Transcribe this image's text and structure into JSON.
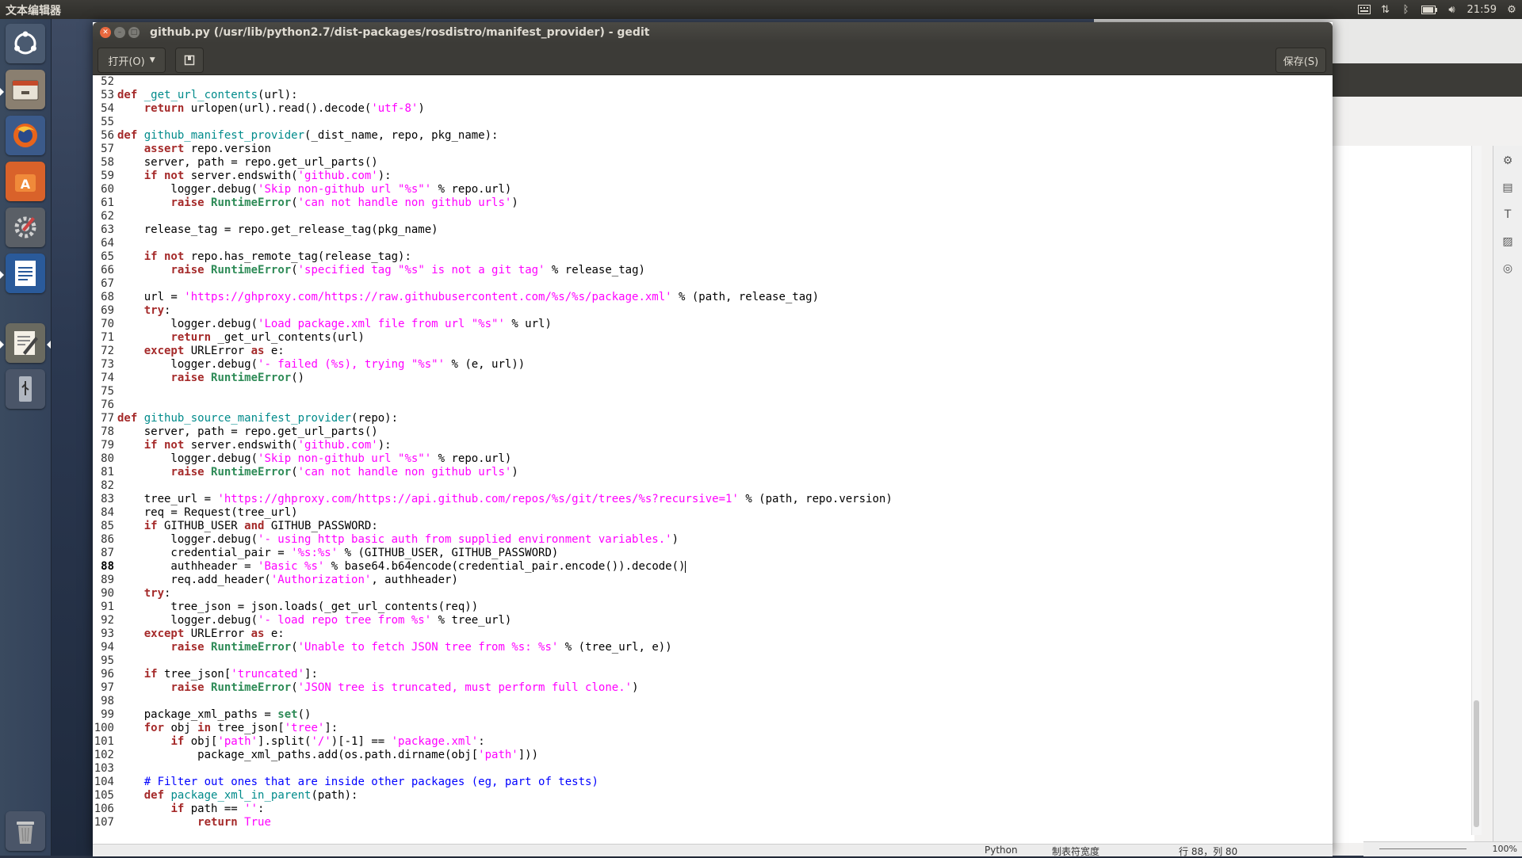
{
  "top_panel": {
    "app_title": "文本编辑器",
    "clock": "21:59",
    "indicators": [
      "keyboard-icon",
      "network-icon",
      "bluetooth-icon",
      "battery-icon",
      "volume-icon",
      "gear-icon"
    ]
  },
  "launcher": {
    "items": [
      "ubuntu-dash",
      "files",
      "firefox",
      "software-center",
      "system-settings",
      "libreoffice-writer",
      "text-editor",
      "usb-drive",
      "trash"
    ]
  },
  "window": {
    "title": "github.py (/usr/lib/python2.7/dist-packages/rosdistro/manifest_provider) - gedit",
    "open_label": "打开(O)",
    "save_label": "保存(S)"
  },
  "editor": {
    "current_line": 88,
    "lines": [
      {
        "n": "52",
        "t": []
      },
      {
        "n": "53",
        "t": [
          [
            "kw",
            "def"
          ],
          [
            "ct",
            " "
          ],
          [
            "fn",
            "_get_url_contents"
          ],
          [
            "ct",
            "(url):"
          ]
        ]
      },
      {
        "n": "54",
        "t": [
          [
            "ct",
            "    "
          ],
          [
            "kw",
            "return"
          ],
          [
            "ct",
            " urlopen(url).read().decode("
          ],
          [
            "st",
            "'utf-8'"
          ],
          [
            "ct",
            ")"
          ]
        ]
      },
      {
        "n": "55",
        "t": []
      },
      {
        "n": "56",
        "t": [
          [
            "kw",
            "def"
          ],
          [
            "ct",
            " "
          ],
          [
            "fn",
            "github_manifest_provider"
          ],
          [
            "ct",
            "(_dist_name, repo, pkg_name):"
          ]
        ]
      },
      {
        "n": "57",
        "t": [
          [
            "ct",
            "    "
          ],
          [
            "kw",
            "assert"
          ],
          [
            "ct",
            " repo.version"
          ]
        ]
      },
      {
        "n": "58",
        "t": [
          [
            "ct",
            "    server, path = repo.get_url_parts()"
          ]
        ]
      },
      {
        "n": "59",
        "t": [
          [
            "ct",
            "    "
          ],
          [
            "kw",
            "if not"
          ],
          [
            "ct",
            " server.endswith("
          ],
          [
            "st",
            "'github.com'"
          ],
          [
            "ct",
            "):"
          ]
        ]
      },
      {
        "n": "60",
        "t": [
          [
            "ct",
            "        logger.debug("
          ],
          [
            "st",
            "'Skip non-github url \"%s\"'"
          ],
          [
            "ct",
            " % repo.url)"
          ]
        ]
      },
      {
        "n": "61",
        "t": [
          [
            "ct",
            "        "
          ],
          [
            "kw",
            "raise"
          ],
          [
            "ct",
            " "
          ],
          [
            "bi",
            "RuntimeError"
          ],
          [
            "ct",
            "("
          ],
          [
            "st",
            "'can not handle non github urls'"
          ],
          [
            "ct",
            ")"
          ]
        ]
      },
      {
        "n": "62",
        "t": []
      },
      {
        "n": "63",
        "t": [
          [
            "ct",
            "    release_tag = repo.get_release_tag(pkg_name)"
          ]
        ]
      },
      {
        "n": "64",
        "t": []
      },
      {
        "n": "65",
        "t": [
          [
            "ct",
            "    "
          ],
          [
            "kw",
            "if not"
          ],
          [
            "ct",
            " repo.has_remote_tag(release_tag):"
          ]
        ]
      },
      {
        "n": "66",
        "t": [
          [
            "ct",
            "        "
          ],
          [
            "kw",
            "raise"
          ],
          [
            "ct",
            " "
          ],
          [
            "bi",
            "RuntimeError"
          ],
          [
            "ct",
            "("
          ],
          [
            "st",
            "'specified tag \"%s\" is not a git tag'"
          ],
          [
            "ct",
            " % release_tag)"
          ]
        ]
      },
      {
        "n": "67",
        "t": []
      },
      {
        "n": "68",
        "t": [
          [
            "ct",
            "    url = "
          ],
          [
            "st",
            "'https://ghproxy.com/https://raw.githubusercontent.com/%s/%s/package.xml'"
          ],
          [
            "ct",
            " % (path, release_tag)"
          ]
        ]
      },
      {
        "n": "69",
        "t": [
          [
            "ct",
            "    "
          ],
          [
            "kw",
            "try"
          ],
          [
            "ct",
            ":"
          ]
        ]
      },
      {
        "n": "70",
        "t": [
          [
            "ct",
            "        logger.debug("
          ],
          [
            "st",
            "'Load package.xml file from url \"%s\"'"
          ],
          [
            "ct",
            " % url)"
          ]
        ]
      },
      {
        "n": "71",
        "t": [
          [
            "ct",
            "        "
          ],
          [
            "kw",
            "return"
          ],
          [
            "ct",
            " _get_url_contents(url)"
          ]
        ]
      },
      {
        "n": "72",
        "t": [
          [
            "ct",
            "    "
          ],
          [
            "kw",
            "except"
          ],
          [
            "ct",
            " URLError "
          ],
          [
            "kw",
            "as"
          ],
          [
            "ct",
            " e:"
          ]
        ]
      },
      {
        "n": "73",
        "t": [
          [
            "ct",
            "        logger.debug("
          ],
          [
            "st",
            "'- failed (%s), trying \"%s\"'"
          ],
          [
            "ct",
            " % (e, url))"
          ]
        ]
      },
      {
        "n": "74",
        "t": [
          [
            "ct",
            "        "
          ],
          [
            "kw",
            "raise"
          ],
          [
            "ct",
            " "
          ],
          [
            "bi",
            "RuntimeError"
          ],
          [
            "ct",
            "()"
          ]
        ]
      },
      {
        "n": "75",
        "t": []
      },
      {
        "n": "76",
        "t": []
      },
      {
        "n": "77",
        "t": [
          [
            "kw",
            "def"
          ],
          [
            "ct",
            " "
          ],
          [
            "fn",
            "github_source_manifest_provider"
          ],
          [
            "ct",
            "(repo):"
          ]
        ]
      },
      {
        "n": "78",
        "t": [
          [
            "ct",
            "    server, path = repo.get_url_parts()"
          ]
        ]
      },
      {
        "n": "79",
        "t": [
          [
            "ct",
            "    "
          ],
          [
            "kw",
            "if not"
          ],
          [
            "ct",
            " server.endswith("
          ],
          [
            "st",
            "'github.com'"
          ],
          [
            "ct",
            "):"
          ]
        ]
      },
      {
        "n": "80",
        "t": [
          [
            "ct",
            "        logger.debug("
          ],
          [
            "st",
            "'Skip non-github url \"%s\"'"
          ],
          [
            "ct",
            " % repo.url)"
          ]
        ]
      },
      {
        "n": "81",
        "t": [
          [
            "ct",
            "        "
          ],
          [
            "kw",
            "raise"
          ],
          [
            "ct",
            " "
          ],
          [
            "bi",
            "RuntimeError"
          ],
          [
            "ct",
            "("
          ],
          [
            "st",
            "'can not handle non github urls'"
          ],
          [
            "ct",
            ")"
          ]
        ]
      },
      {
        "n": "82",
        "t": []
      },
      {
        "n": "83",
        "t": [
          [
            "ct",
            "    tree_url = "
          ],
          [
            "st",
            "'https://ghproxy.com/https://api.github.com/repos/%s/git/trees/%s?recursive=1'"
          ],
          [
            "ct",
            " % (path, repo.version)"
          ]
        ]
      },
      {
        "n": "84",
        "t": [
          [
            "ct",
            "    req = Request(tree_url)"
          ]
        ]
      },
      {
        "n": "85",
        "t": [
          [
            "ct",
            "    "
          ],
          [
            "kw",
            "if"
          ],
          [
            "ct",
            " GITHUB_USER "
          ],
          [
            "kw",
            "and"
          ],
          [
            "ct",
            " GITHUB_PASSWORD:"
          ]
        ]
      },
      {
        "n": "86",
        "t": [
          [
            "ct",
            "        logger.debug("
          ],
          [
            "st",
            "'- using http basic auth from supplied environment variables.'"
          ],
          [
            "ct",
            ")"
          ]
        ]
      },
      {
        "n": "87",
        "t": [
          [
            "ct",
            "        credential_pair = "
          ],
          [
            "st",
            "'%s:%s'"
          ],
          [
            "ct",
            " % (GITHUB_USER, GITHUB_PASSWORD)"
          ]
        ]
      },
      {
        "n": "88",
        "t": [
          [
            "ct",
            "        authheader = "
          ],
          [
            "st",
            "'Basic %s'"
          ],
          [
            "ct",
            " % base64.b64encode(credential_pair.encode()).decode()"
          ]
        ]
      },
      {
        "n": "89",
        "t": [
          [
            "ct",
            "        req.add_header("
          ],
          [
            "st",
            "'Authorization'"
          ],
          [
            "ct",
            ", authheader)"
          ]
        ]
      },
      {
        "n": "90",
        "t": [
          [
            "ct",
            "    "
          ],
          [
            "kw",
            "try"
          ],
          [
            "ct",
            ":"
          ]
        ]
      },
      {
        "n": "91",
        "t": [
          [
            "ct",
            "        tree_json = json.loads(_get_url_contents(req))"
          ]
        ]
      },
      {
        "n": "92",
        "t": [
          [
            "ct",
            "        logger.debug("
          ],
          [
            "st",
            "'- load repo tree from %s'"
          ],
          [
            "ct",
            " % tree_url)"
          ]
        ]
      },
      {
        "n": "93",
        "t": [
          [
            "ct",
            "    "
          ],
          [
            "kw",
            "except"
          ],
          [
            "ct",
            " URLError "
          ],
          [
            "kw",
            "as"
          ],
          [
            "ct",
            " e:"
          ]
        ]
      },
      {
        "n": "94",
        "t": [
          [
            "ct",
            "        "
          ],
          [
            "kw",
            "raise"
          ],
          [
            "ct",
            " "
          ],
          [
            "bi",
            "RuntimeError"
          ],
          [
            "ct",
            "("
          ],
          [
            "st",
            "'Unable to fetch JSON tree from %s: %s'"
          ],
          [
            "ct",
            " % (tree_url, e))"
          ]
        ]
      },
      {
        "n": "95",
        "t": []
      },
      {
        "n": "96",
        "t": [
          [
            "ct",
            "    "
          ],
          [
            "kw",
            "if"
          ],
          [
            "ct",
            " tree_json["
          ],
          [
            "st",
            "'truncated'"
          ],
          [
            "ct",
            "]:"
          ]
        ]
      },
      {
        "n": "97",
        "t": [
          [
            "ct",
            "        "
          ],
          [
            "kw",
            "raise"
          ],
          [
            "ct",
            " "
          ],
          [
            "bi",
            "RuntimeError"
          ],
          [
            "ct",
            "("
          ],
          [
            "st",
            "'JSON tree is truncated, must perform full clone.'"
          ],
          [
            "ct",
            ")"
          ]
        ]
      },
      {
        "n": "98",
        "t": []
      },
      {
        "n": "99",
        "t": [
          [
            "ct",
            "    package_xml_paths = "
          ],
          [
            "bi",
            "set"
          ],
          [
            "ct",
            "()"
          ]
        ]
      },
      {
        "n": "100",
        "t": [
          [
            "ct",
            "    "
          ],
          [
            "kw",
            "for"
          ],
          [
            "ct",
            " obj "
          ],
          [
            "kw",
            "in"
          ],
          [
            "ct",
            " tree_json["
          ],
          [
            "st",
            "'tree'"
          ],
          [
            "ct",
            "]:"
          ]
        ]
      },
      {
        "n": "101",
        "t": [
          [
            "ct",
            "        "
          ],
          [
            "kw",
            "if"
          ],
          [
            "ct",
            " obj["
          ],
          [
            "st",
            "'path'"
          ],
          [
            "ct",
            "].split("
          ],
          [
            "st",
            "'/'"
          ],
          [
            "ct",
            ")[-1] == "
          ],
          [
            "st",
            "'package.xml'"
          ],
          [
            "ct",
            ":"
          ]
        ]
      },
      {
        "n": "102",
        "t": [
          [
            "ct",
            "            package_xml_paths.add(os.path.dirname(obj["
          ],
          [
            "st",
            "'path'"
          ],
          [
            "ct",
            "]))"
          ]
        ]
      },
      {
        "n": "103",
        "t": []
      },
      {
        "n": "104",
        "t": [
          [
            "ct",
            "    "
          ],
          [
            "cm",
            "# Filter out ones that are inside other packages (eg, part of tests)"
          ]
        ]
      },
      {
        "n": "105",
        "t": [
          [
            "ct",
            "    "
          ],
          [
            "kw",
            "def"
          ],
          [
            "ct",
            " "
          ],
          [
            "fn",
            "package_xml_in_parent"
          ],
          [
            "ct",
            "(path):"
          ]
        ]
      },
      {
        "n": "106",
        "t": [
          [
            "ct",
            "        "
          ],
          [
            "kw",
            "if"
          ],
          [
            "ct",
            " path == "
          ],
          [
            "st",
            "''"
          ],
          [
            "ct",
            ":"
          ]
        ]
      },
      {
        "n": "107",
        "t": [
          [
            "ct",
            "            "
          ],
          [
            "kw",
            "return"
          ],
          [
            "ct",
            " "
          ],
          [
            "st",
            "True"
          ]
        ]
      }
    ]
  },
  "statusbar": {
    "language": "Python",
    "tab_width": "制表符宽度",
    "position": "行 88，列 80"
  },
  "right_panel": {
    "zoom": "100%"
  },
  "colors": {
    "keyword": "#a52a2a",
    "function": "#008b8b",
    "string": "#ff00ff",
    "builtin": "#2e8b57",
    "comment": "#0000ff"
  }
}
